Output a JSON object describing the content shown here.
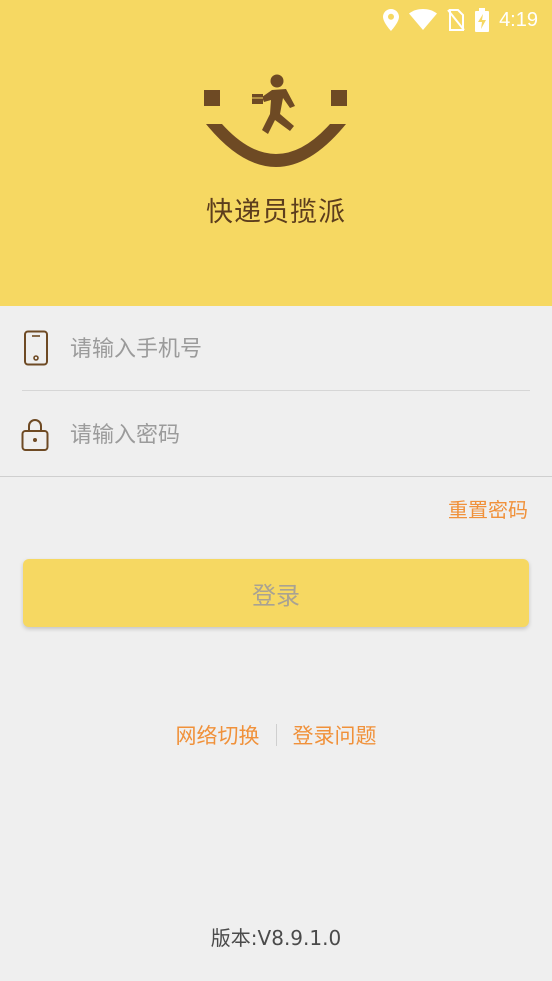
{
  "status_bar": {
    "time": "4:19",
    "icons": [
      "location-icon",
      "wifi-icon",
      "no-sim-icon",
      "battery-charging-icon"
    ]
  },
  "brand": {
    "app_name": "快递员揽派",
    "logo": "courier-smile-logo"
  },
  "colors": {
    "header_bg": "#f6d862",
    "logo_brown": "#6e4a24",
    "accent_orange": "#f0913a",
    "page_bg": "#efefef"
  },
  "login_form": {
    "phone_placeholder": "请输入手机号",
    "phone_icon": "phone-icon",
    "password_placeholder": "请输入密码",
    "password_icon": "lock-icon",
    "reset_password": "重置密码",
    "login_button": "登录"
  },
  "footer_links": {
    "network_switch": "网络切换",
    "login_issues": "登录问题"
  },
  "version": "版本:V8.9.1.0"
}
